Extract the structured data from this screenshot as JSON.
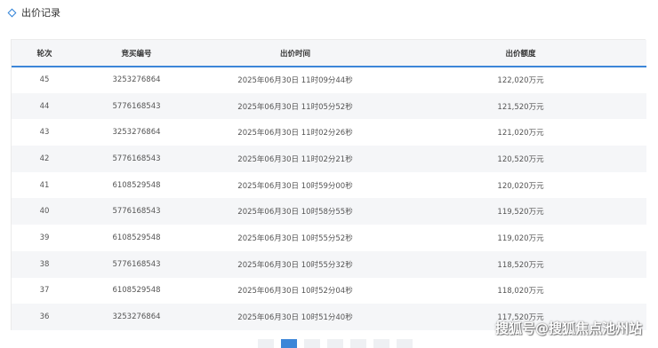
{
  "section": {
    "title": "出价记录"
  },
  "table": {
    "headers": [
      "轮次",
      "竞买编号",
      "出价时间",
      "出价额度"
    ],
    "rows": [
      {
        "round": "45",
        "bidder": "3253276864",
        "time": "2025年06月30日 11时09分44秒",
        "amount": "122,020万元"
      },
      {
        "round": "44",
        "bidder": "5776168543",
        "time": "2025年06月30日 11时05分52秒",
        "amount": "121,520万元"
      },
      {
        "round": "43",
        "bidder": "3253276864",
        "time": "2025年06月30日 11时02分26秒",
        "amount": "121,020万元"
      },
      {
        "round": "42",
        "bidder": "5776168543",
        "time": "2025年06月30日 11时02分21秒",
        "amount": "120,520万元"
      },
      {
        "round": "41",
        "bidder": "6108529548",
        "time": "2025年06月30日 10时59分00秒",
        "amount": "120,020万元"
      },
      {
        "round": "40",
        "bidder": "5776168543",
        "time": "2025年06月30日 10时58分55秒",
        "amount": "119,520万元"
      },
      {
        "round": "39",
        "bidder": "6108529548",
        "time": "2025年06月30日 10时55分52秒",
        "amount": "119,020万元"
      },
      {
        "round": "38",
        "bidder": "5776168543",
        "time": "2025年06月30日 10时55分32秒",
        "amount": "118,520万元"
      },
      {
        "round": "37",
        "bidder": "6108529548",
        "time": "2025年06月30日 10时52分04秒",
        "amount": "118,020万元"
      },
      {
        "round": "36",
        "bidder": "3253276864",
        "time": "2025年06月30日 10时51分40秒",
        "amount": "117,520万元"
      }
    ]
  },
  "watermark": {
    "text": "搜狐号@搜狐焦点池州站"
  },
  "colors": {
    "accent": "#3c86d8",
    "stripe": "#f5f6f8"
  },
  "icons": {
    "section": "diamond-icon"
  }
}
